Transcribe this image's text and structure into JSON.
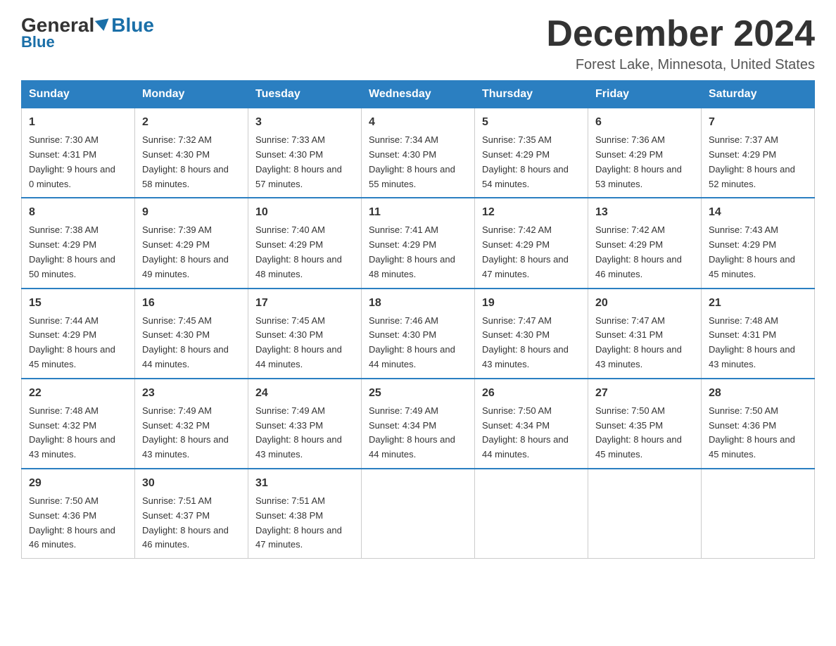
{
  "header": {
    "logo_general": "General",
    "logo_blue": "Blue",
    "month_title": "December 2024",
    "location": "Forest Lake, Minnesota, United States"
  },
  "days_of_week": [
    "Sunday",
    "Monday",
    "Tuesday",
    "Wednesday",
    "Thursday",
    "Friday",
    "Saturday"
  ],
  "weeks": [
    [
      {
        "num": "1",
        "sunrise": "7:30 AM",
        "sunset": "4:31 PM",
        "daylight": "9 hours and 0 minutes."
      },
      {
        "num": "2",
        "sunrise": "7:32 AM",
        "sunset": "4:30 PM",
        "daylight": "8 hours and 58 minutes."
      },
      {
        "num": "3",
        "sunrise": "7:33 AM",
        "sunset": "4:30 PM",
        "daylight": "8 hours and 57 minutes."
      },
      {
        "num": "4",
        "sunrise": "7:34 AM",
        "sunset": "4:30 PM",
        "daylight": "8 hours and 55 minutes."
      },
      {
        "num": "5",
        "sunrise": "7:35 AM",
        "sunset": "4:29 PM",
        "daylight": "8 hours and 54 minutes."
      },
      {
        "num": "6",
        "sunrise": "7:36 AM",
        "sunset": "4:29 PM",
        "daylight": "8 hours and 53 minutes."
      },
      {
        "num": "7",
        "sunrise": "7:37 AM",
        "sunset": "4:29 PM",
        "daylight": "8 hours and 52 minutes."
      }
    ],
    [
      {
        "num": "8",
        "sunrise": "7:38 AM",
        "sunset": "4:29 PM",
        "daylight": "8 hours and 50 minutes."
      },
      {
        "num": "9",
        "sunrise": "7:39 AM",
        "sunset": "4:29 PM",
        "daylight": "8 hours and 49 minutes."
      },
      {
        "num": "10",
        "sunrise": "7:40 AM",
        "sunset": "4:29 PM",
        "daylight": "8 hours and 48 minutes."
      },
      {
        "num": "11",
        "sunrise": "7:41 AM",
        "sunset": "4:29 PM",
        "daylight": "8 hours and 48 minutes."
      },
      {
        "num": "12",
        "sunrise": "7:42 AM",
        "sunset": "4:29 PM",
        "daylight": "8 hours and 47 minutes."
      },
      {
        "num": "13",
        "sunrise": "7:42 AM",
        "sunset": "4:29 PM",
        "daylight": "8 hours and 46 minutes."
      },
      {
        "num": "14",
        "sunrise": "7:43 AM",
        "sunset": "4:29 PM",
        "daylight": "8 hours and 45 minutes."
      }
    ],
    [
      {
        "num": "15",
        "sunrise": "7:44 AM",
        "sunset": "4:29 PM",
        "daylight": "8 hours and 45 minutes."
      },
      {
        "num": "16",
        "sunrise": "7:45 AM",
        "sunset": "4:30 PM",
        "daylight": "8 hours and 44 minutes."
      },
      {
        "num": "17",
        "sunrise": "7:45 AM",
        "sunset": "4:30 PM",
        "daylight": "8 hours and 44 minutes."
      },
      {
        "num": "18",
        "sunrise": "7:46 AM",
        "sunset": "4:30 PM",
        "daylight": "8 hours and 44 minutes."
      },
      {
        "num": "19",
        "sunrise": "7:47 AM",
        "sunset": "4:30 PM",
        "daylight": "8 hours and 43 minutes."
      },
      {
        "num": "20",
        "sunrise": "7:47 AM",
        "sunset": "4:31 PM",
        "daylight": "8 hours and 43 minutes."
      },
      {
        "num": "21",
        "sunrise": "7:48 AM",
        "sunset": "4:31 PM",
        "daylight": "8 hours and 43 minutes."
      }
    ],
    [
      {
        "num": "22",
        "sunrise": "7:48 AM",
        "sunset": "4:32 PM",
        "daylight": "8 hours and 43 minutes."
      },
      {
        "num": "23",
        "sunrise": "7:49 AM",
        "sunset": "4:32 PM",
        "daylight": "8 hours and 43 minutes."
      },
      {
        "num": "24",
        "sunrise": "7:49 AM",
        "sunset": "4:33 PM",
        "daylight": "8 hours and 43 minutes."
      },
      {
        "num": "25",
        "sunrise": "7:49 AM",
        "sunset": "4:34 PM",
        "daylight": "8 hours and 44 minutes."
      },
      {
        "num": "26",
        "sunrise": "7:50 AM",
        "sunset": "4:34 PM",
        "daylight": "8 hours and 44 minutes."
      },
      {
        "num": "27",
        "sunrise": "7:50 AM",
        "sunset": "4:35 PM",
        "daylight": "8 hours and 45 minutes."
      },
      {
        "num": "28",
        "sunrise": "7:50 AM",
        "sunset": "4:36 PM",
        "daylight": "8 hours and 45 minutes."
      }
    ],
    [
      {
        "num": "29",
        "sunrise": "7:50 AM",
        "sunset": "4:36 PM",
        "daylight": "8 hours and 46 minutes."
      },
      {
        "num": "30",
        "sunrise": "7:51 AM",
        "sunset": "4:37 PM",
        "daylight": "8 hours and 46 minutes."
      },
      {
        "num": "31",
        "sunrise": "7:51 AM",
        "sunset": "4:38 PM",
        "daylight": "8 hours and 47 minutes."
      },
      null,
      null,
      null,
      null
    ]
  ]
}
